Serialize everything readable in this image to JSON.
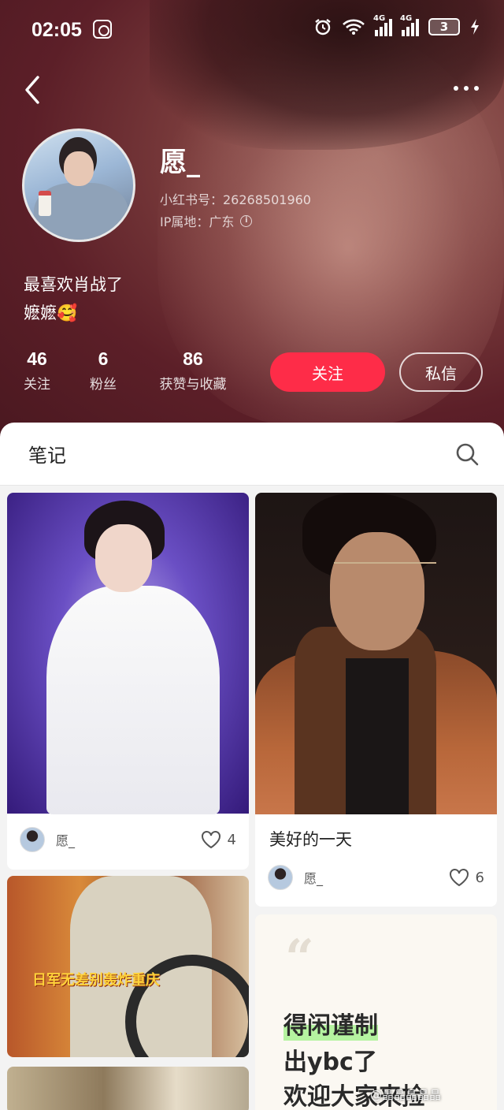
{
  "status_bar": {
    "time": "02:05",
    "network_1": "4G",
    "network_2": "4G",
    "battery": "3"
  },
  "profile": {
    "name": "愿_",
    "id_line": "小红书号：26268501960",
    "ip_line": "IP属地：广东",
    "bio_line_1": "最喜欢肖战了",
    "bio_line_2": "嬷嬷🥰"
  },
  "stats": [
    {
      "value": "46",
      "label": "关注"
    },
    {
      "value": "6",
      "label": "粉丝"
    },
    {
      "value": "86",
      "label": "获赞与收藏"
    }
  ],
  "actions": {
    "follow": "关注",
    "message": "私信"
  },
  "tabs": {
    "notes": "笔记"
  },
  "feed": [
    {
      "author": "愿_",
      "likes": "4"
    },
    {
      "title": "美好的一天",
      "author": "愿_",
      "likes": "6"
    },
    {
      "caption": "日军无差别轰炸重庆"
    },
    {
      "quote_line_1": "得闲谨制",
      "quote_line_2": "出ybc了",
      "quote_line_3": "欢迎大家来捡"
    }
  ],
  "watermark": "@晶晶晶晶晶",
  "colors": {
    "accent": "#fe2c48",
    "header_bg": "#5c1f28"
  }
}
